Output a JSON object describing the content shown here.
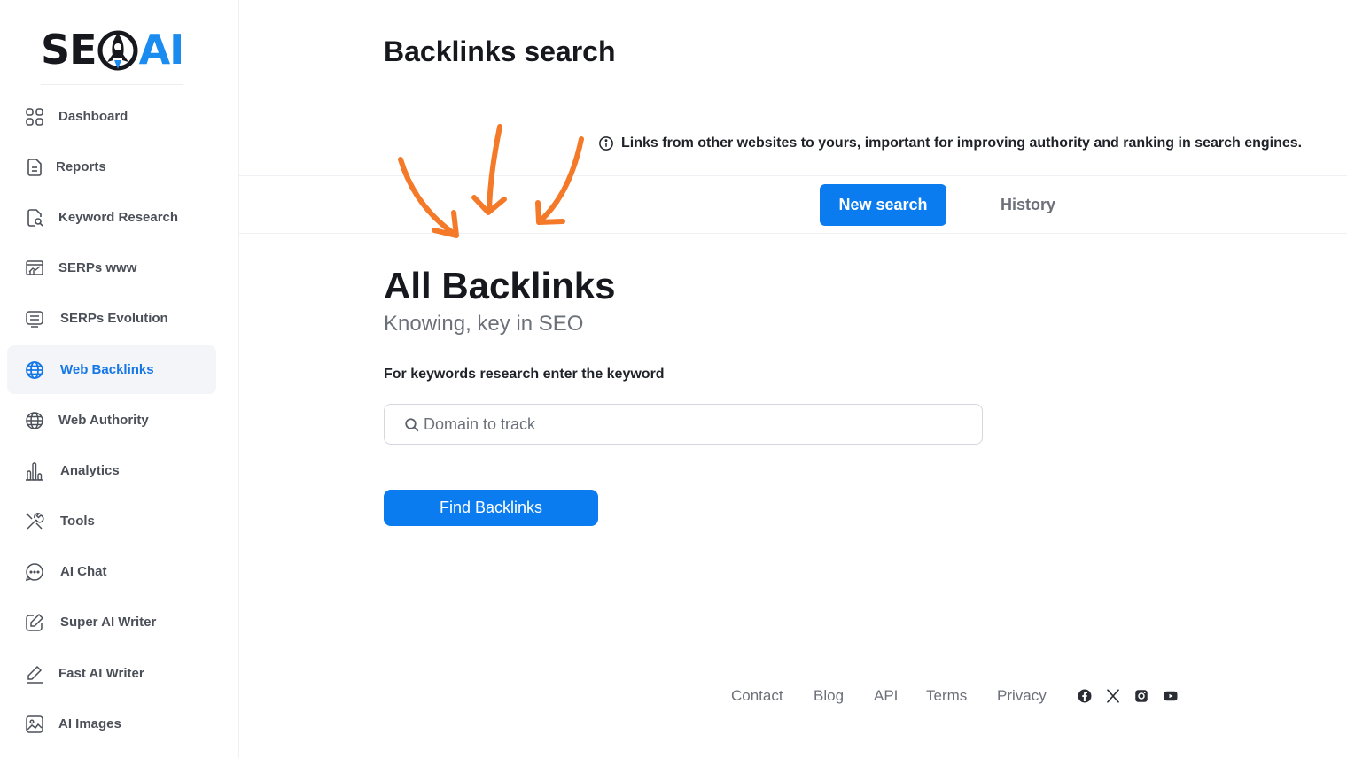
{
  "brand": {
    "logo_left": "SE",
    "logo_right": "AI",
    "accent": "#1a8cf0",
    "dark": "#16181d"
  },
  "sidebar": {
    "items": [
      {
        "label": "Dashboard",
        "icon": "grid-icon"
      },
      {
        "label": "Reports",
        "icon": "document-icon"
      },
      {
        "label": "Keyword Research",
        "icon": "file-search-icon"
      },
      {
        "label": "SERPs www",
        "icon": "browser-chart-icon"
      },
      {
        "label": "SERPs Evolution",
        "icon": "monitor-icon"
      },
      {
        "label": "Web Backlinks",
        "icon": "globe-icon",
        "active": true
      },
      {
        "label": "Web Authority",
        "icon": "globe-icon"
      },
      {
        "label": "Analytics",
        "icon": "bar-chart-icon"
      },
      {
        "label": "Tools",
        "icon": "tools-icon"
      },
      {
        "label": "AI Chat",
        "icon": "chat-bubble-icon"
      },
      {
        "label": "Super AI Writer",
        "icon": "edit-icon"
      },
      {
        "label": "Fast AI Writer",
        "icon": "pen-icon"
      },
      {
        "label": "AI Images",
        "icon": "image-icon"
      }
    ],
    "active_color": "#1677e6"
  },
  "header": {
    "title": "Backlinks search",
    "info": "Links from other websites to yours, important for improving authority and ranking in search engines."
  },
  "tabs": {
    "new_search": "New search",
    "history": "History"
  },
  "main": {
    "title": "All Backlinks",
    "subtitle": "Knowing, key in SEO",
    "field_label": "For keywords research enter the keyword",
    "search_placeholder": "Domain to track",
    "search_value": "",
    "button": "Find Backlinks",
    "primary_color": "#0a7cf0",
    "annotation_color": "#f47a2a"
  },
  "footer": {
    "links": [
      "Contact",
      "Blog",
      "API",
      "Terms",
      "Privacy"
    ],
    "social": [
      "facebook-icon",
      "x-icon",
      "instagram-icon",
      "youtube-icon"
    ]
  }
}
